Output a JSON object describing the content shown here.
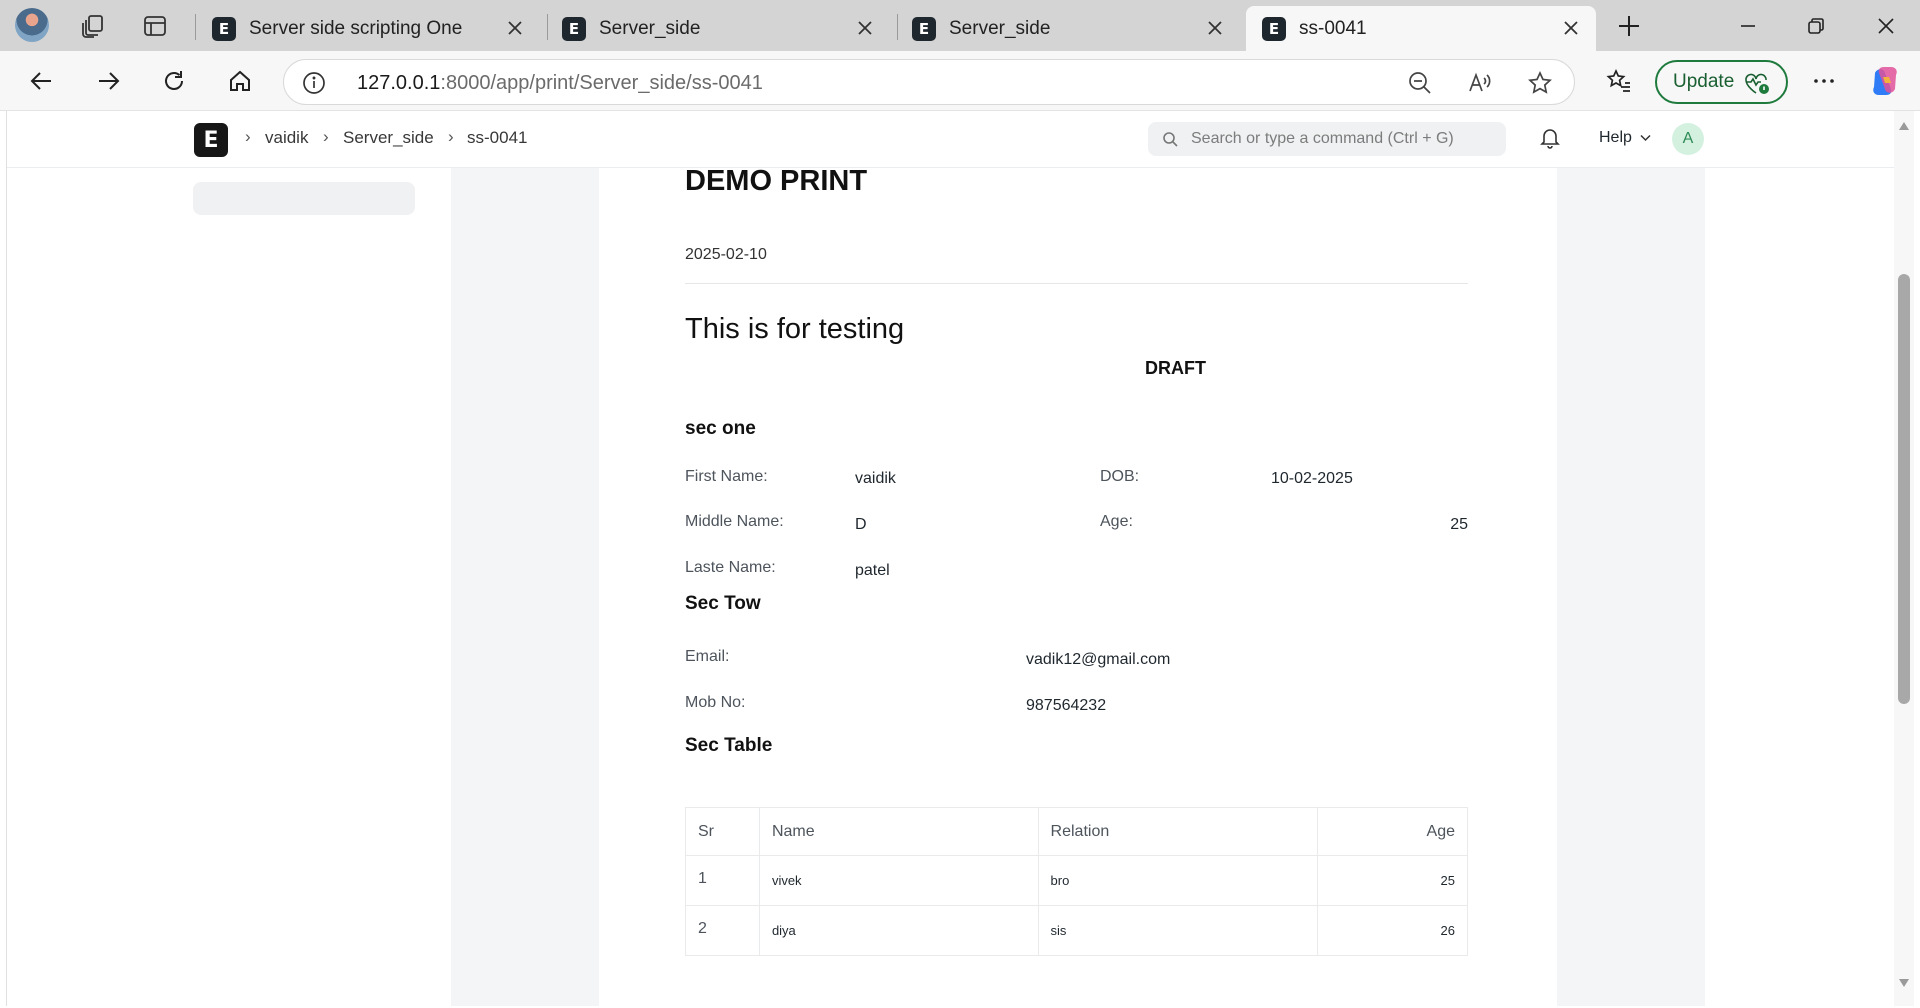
{
  "browser": {
    "tabs": [
      {
        "title": "Server side scripting One",
        "favicon": "E",
        "active": false
      },
      {
        "title": "Server_side",
        "favicon": "E",
        "active": false
      },
      {
        "title": "Server_side",
        "favicon": "E",
        "active": false
      },
      {
        "title": "ss-0041",
        "favicon": "E",
        "active": true
      }
    ],
    "address": {
      "host": "127.0.0.1",
      "rest": ":8000/app/print/Server_side/ss-0041"
    },
    "update_label": "Update",
    "accent_color": "#1e7a3d"
  },
  "app": {
    "logo_letter": "E",
    "breadcrumbs": [
      "vaidik",
      "Server_side",
      "ss-0041"
    ],
    "search_placeholder": "Search or type a command (Ctrl + G)",
    "help_label": "Help",
    "avatar_letter": "A"
  },
  "print": {
    "title": "DEMO PRINT",
    "date": "2025-02-10",
    "subtitle": "This is for testing",
    "status": "DRAFT",
    "section_one": {
      "heading": "sec one",
      "first_name_label": "First Name:",
      "first_name": "vaidik",
      "dob_label": "DOB:",
      "dob": "10-02-2025",
      "middle_name_label": "Middle Name:",
      "middle_name": "D",
      "age_label": "Age:",
      "age": "25",
      "last_name_label": "Laste Name:",
      "last_name": "patel"
    },
    "section_two": {
      "heading": "Sec Tow",
      "email_label": "Email:",
      "email": "vadik12@gmail.com",
      "mob_label": "Mob No:",
      "mob": "987564232"
    },
    "section_table": {
      "heading": "Sec Table",
      "columns": [
        "Sr",
        "Name",
        "Relation",
        "Age"
      ],
      "rows": [
        {
          "sr": "1",
          "name": "vivek",
          "relation": "bro",
          "age": "25"
        },
        {
          "sr": "2",
          "name": "diya",
          "relation": "sis",
          "age": "26"
        }
      ]
    }
  }
}
